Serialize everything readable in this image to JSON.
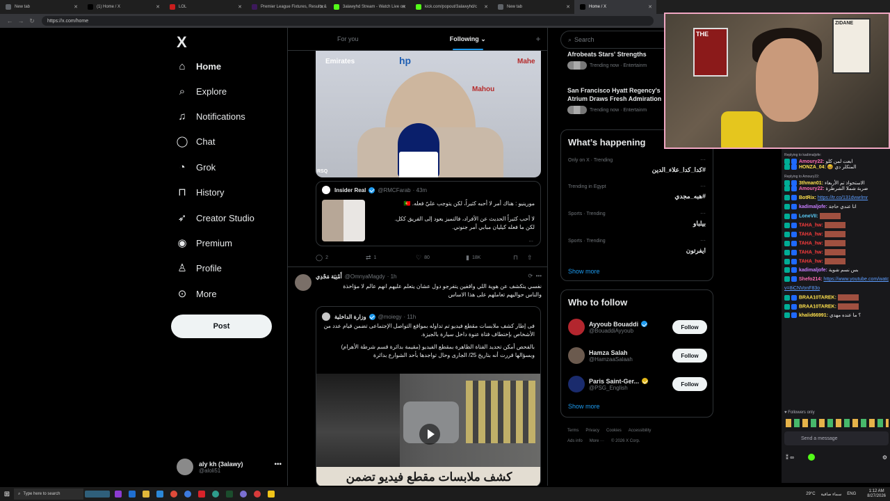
{
  "browser": {
    "tabs": [
      {
        "label": "New tab",
        "color": "#5f6368"
      },
      {
        "label": "(1) Home / X",
        "color": "#000000"
      },
      {
        "label": "LOL",
        "color": "#c91d1d"
      },
      {
        "label": "Premier League Fixtures, Results &",
        "color": "#3d195b"
      },
      {
        "label": "3alawyhd Stream - Watch Live on",
        "color": "#53fc18"
      },
      {
        "label": "kick.com/popout/3alawyhd/c",
        "color": "#53fc18"
      },
      {
        "label": "New tab",
        "color": "#5f6368"
      },
      {
        "label": "Home / X",
        "color": "#000000"
      }
    ],
    "url": "https://x.com/home"
  },
  "leftnav": {
    "logo": "X",
    "items": [
      {
        "label": "Home",
        "icon": "home-icon",
        "bold": true
      },
      {
        "label": "Explore",
        "icon": "search-icon"
      },
      {
        "label": "Notifications",
        "icon": "bell-icon"
      },
      {
        "label": "Chat",
        "icon": "chat-icon"
      },
      {
        "label": "Grok",
        "icon": "grok-icon"
      },
      {
        "label": "History",
        "icon": "bookmark-icon"
      },
      {
        "label": "Creator Studio",
        "icon": "rocket-icon"
      },
      {
        "label": "Premium",
        "icon": "premium-icon"
      },
      {
        "label": "Profile",
        "icon": "profile-icon"
      },
      {
        "label": "More",
        "icon": "more-icon"
      }
    ],
    "post_label": "Post",
    "profile": {
      "name": "aly kh (3alawy)",
      "handle": "@aloli51"
    }
  },
  "feed": {
    "tabs": [
      {
        "label": "For you"
      },
      {
        "label": "Following ⌄"
      }
    ],
    "plus": "+",
    "video1": {
      "brand_left": "Emirates",
      "brand_hp": "hp",
      "brand_mahou": "Mahou",
      "brand_right": "Mahe",
      "badge": "RSQ"
    },
    "quote1": {
      "name": "Insider Real",
      "handle": "@RMCFarab",
      "time": "· 43m",
      "line1": "مورينيو : هناك أمر لا أحبه كثيراً، لكن يتوجب عليّ فعله. 🇵🇹",
      "line2": "لا أحب كثيراً الحديث عن الأفراد، فالتميز يعود إلى الفريق ككل.",
      "line3": "لكن ما فعله كيليان مبابي أمر جنوني.",
      "more": "..."
    },
    "actions1": {
      "replies": "2",
      "reposts": "1",
      "likes": "80",
      "views": "18K"
    },
    "post2": {
      "name": "أَمْنِيَة مَجْدِي",
      "handle": "@OmnyaMagdy",
      "time": "· 1h",
      "line1": "نفسي يتكشف عن هوية اللي واقفين يتفرجو دول عشان يتعلم عليهم انهم عالم لا مؤاخذة",
      "line2": "والناس حواليهم تعاملهم على هذا الاساس"
    },
    "quote2": {
      "name": "وزارة الداخلية",
      "handle": "@moiegy",
      "time": "· 11h",
      "p1": "فى إطار كشف ملابسات مقطع فيديو تم تداوله بمواقع التواصل الإجتماعى تضمن قيام عدد من الأشخاص بإختطاف فتاة عنوة داخل سيارة بالجيزة.",
      "p2": "بالفحص أمكن تحديد الفتاة الظاهرة بمقطع الفيديو (مقيمة بدائرة قسم شرطة الأهرام) وبسؤالها قررت أنه بتاريخ 25/ الجارى وحال تواجدها بأحد الشوارع بدائرة",
      "caption": "كشف ملابسات مقطع فيديو تضمن"
    }
  },
  "right": {
    "search_placeholder": "Search",
    "top_trends": [
      {
        "title": "Afrobeats Stars' Strengths",
        "meta": "Trending now · Entertainm"
      },
      {
        "title": "San Francisco Hyatt Regency's Atrium Draws Fresh Admiration",
        "meta": "Trending now · Entertainm"
      }
    ],
    "happening": {
      "title": "What’s happening",
      "trends": [
        {
          "category": "Only on X · Trending",
          "name": "#كدا_كدا_علاء_الدين"
        },
        {
          "category": "Trending in Egypt",
          "name": "#هبه_مجدي"
        },
        {
          "category": "Sports · Trending",
          "name": "بيلباو"
        },
        {
          "category": "Sports · Trending",
          "name": "ايفرتون"
        }
      ],
      "show_more": "Show more"
    },
    "who_to_follow": {
      "title": "Who to follow",
      "users": [
        {
          "name": "Ayyoub Bouaddi",
          "handle": "@BouaddiAyyoub",
          "avatar_color": "#b3262e",
          "verified": "blue"
        },
        {
          "name": "Hamza Salah",
          "handle": "@HamzaaSalaah",
          "avatar_color": "#6b5a4e",
          "verified": ""
        },
        {
          "name": "Paris Saint-Ger...",
          "handle": "@PSG_English",
          "avatar_color": "#1a2b6d",
          "verified": "gold"
        }
      ],
      "follow_label": "Follow",
      "show_more": "Show more"
    },
    "footer": {
      "row1": [
        "Terms",
        "Privacy",
        "Cookies",
        "Accessibility"
      ],
      "row2": [
        "Ads info",
        "More ···",
        "© 2026 X Corp."
      ]
    }
  },
  "webcam": {
    "poster_left": "THE",
    "poster_right": "ZIDANE"
  },
  "chat": {
    "messages": [
      {
        "reply": "Replying to kadimaljofe:",
        "user": "Amoury22:",
        "color": "#ff6bb5",
        "text": "ابعت لمن كلو"
      },
      {
        "reply": "",
        "user": "HONZA_04:",
        "color": "#ffe14d",
        "text": "😆 المتكلر دي"
      },
      {
        "reply": "Replying to Amoury22:",
        "user": "3thman01:",
        "color": "#ffe14d",
        "text": "الاستحواذ تم الأربعاء"
      },
      {
        "reply": "",
        "user": "Amoury22:",
        "color": "#ff6bb5",
        "text": "ضربة شملا الشرطرة"
      },
      {
        "reply": "",
        "user": "BotRix:",
        "color": "#ffe14d",
        "text": "",
        "link": "https://tr.co/131dvwrlmr"
      },
      {
        "reply": "",
        "user": "kadimaljofe:",
        "color": "#c77dff",
        "text": "انا عندي حاجة"
      },
      {
        "reply": "",
        "user": "LoneVII:",
        "color": "#5cd1ff",
        "text": ""
      },
      {
        "reply": "",
        "user": "TAHA_hw:",
        "color": "#ff3d3d",
        "text": ""
      },
      {
        "reply": "",
        "user": "TAHA_hw:",
        "color": "#ff3d3d",
        "text": ""
      },
      {
        "reply": "",
        "user": "TAHA_hw:",
        "color": "#ff3d3d",
        "text": ""
      },
      {
        "reply": "",
        "user": "TAHA_hw:",
        "color": "#ff3d3d",
        "text": ""
      },
      {
        "reply": "",
        "user": "TAHA_hw:",
        "color": "#ff3d3d",
        "text": ""
      },
      {
        "reply": "",
        "user": "kadimaljofe:",
        "color": "#c77dff",
        "text": "بس نسم شوية"
      },
      {
        "reply": "",
        "user": "Shefo214:",
        "color": "#ff6bb5",
        "text": "",
        "link": "https://www.youtube.com/watch?"
      },
      {
        "reply": "",
        "user": "",
        "color": "#5c9dff",
        "text": "",
        "link": "v=8iCNVonF83o"
      },
      {
        "reply": "",
        "user": "BRAA10TAREK:",
        "color": "#ffe14d",
        "text": ""
      },
      {
        "reply": "",
        "user": "BRAA10TAREK:",
        "color": "#ffe14d",
        "text": ""
      },
      {
        "reply": "",
        "user": "khalid66991:",
        "color": "#ffe14d",
        "text": "؟ ما عنده مهدي"
      }
    ],
    "followers_only": "Followers only",
    "input_placeholder": "Send a message"
  },
  "taskbar": {
    "search_placeholder": "Type here to search",
    "weather": "29°C",
    "weather_desc": "سماء صافية",
    "lang": "ENG",
    "time": "1:12 AM",
    "date": "8/27/2026"
  }
}
